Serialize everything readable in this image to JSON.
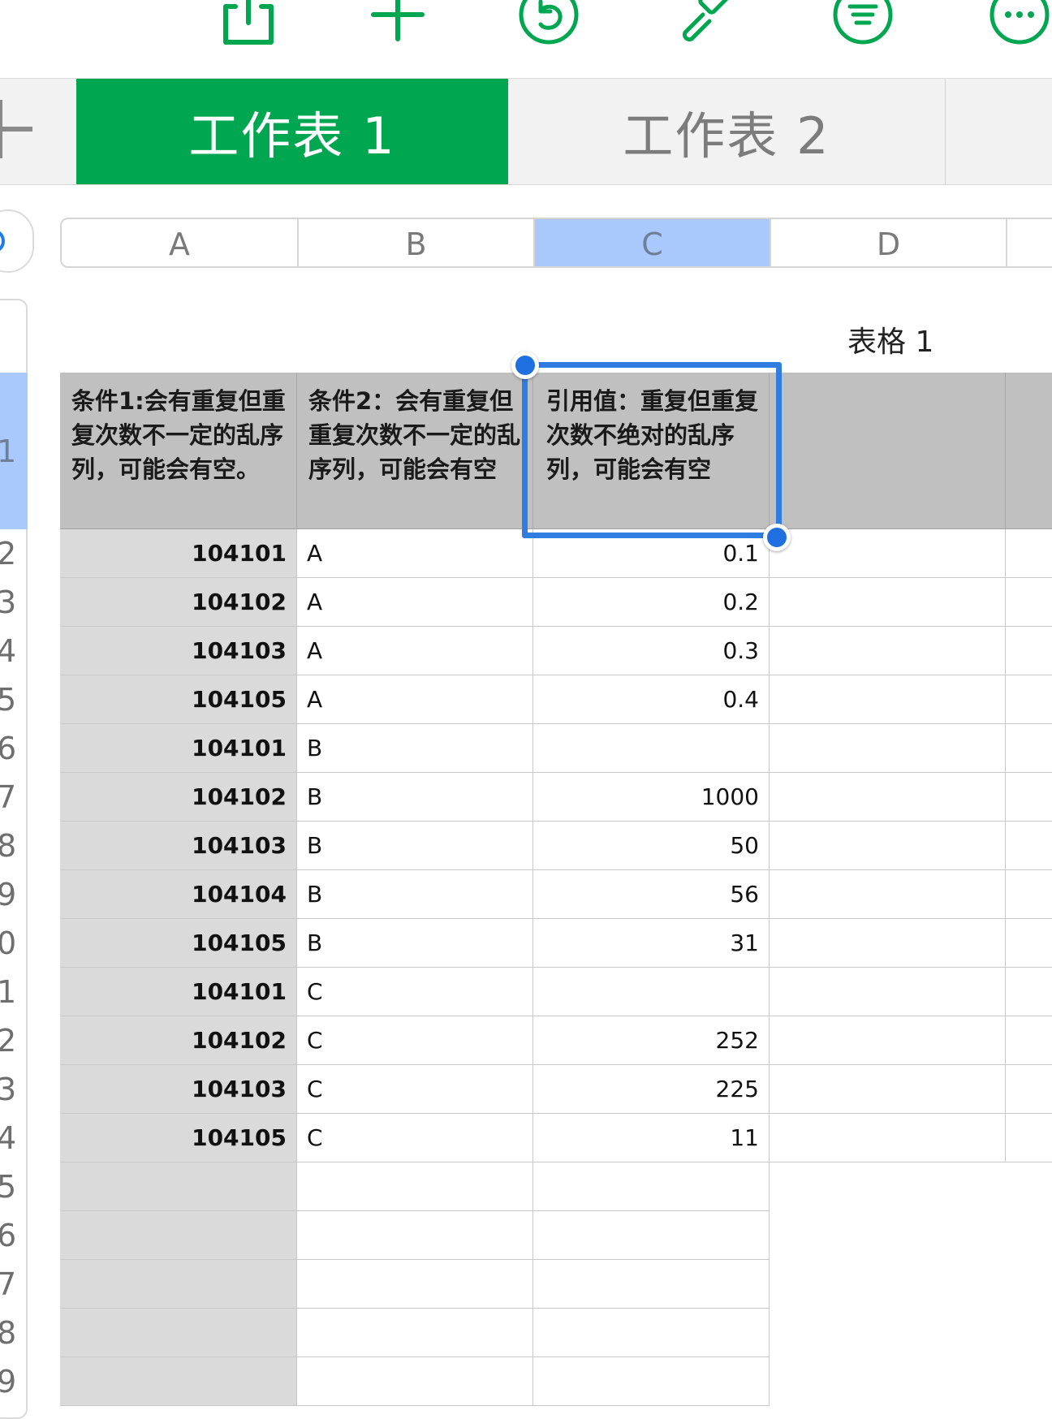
{
  "toolbar": {
    "icons": [
      "back-icon",
      "share-icon",
      "add-icon",
      "undo-icon",
      "brush-icon",
      "format-icon",
      "more-icon"
    ],
    "accent": "#00a650"
  },
  "tabs": {
    "items": [
      {
        "label": "工作表 1",
        "active": true
      },
      {
        "label": "工作表 2",
        "active": false
      }
    ]
  },
  "columns": [
    "A",
    "B",
    "C",
    "D"
  ],
  "selected_column": "C",
  "row_numbers": [
    "1",
    "2",
    "3",
    "4",
    "5",
    "6",
    "7",
    "8",
    "9",
    "0",
    "1",
    "2",
    "3",
    "4",
    "5",
    "6",
    "7",
    "8",
    "9"
  ],
  "table": {
    "title": "表格 1",
    "headers": [
      "条件1:会有重复但重复次数不一定的乱序列，可能会有空。",
      "条件2：会有重复但重复次数不一定的乱序列，可能会有空",
      "引用值：重复但重复次数不绝对的乱序列，可能会有空",
      ""
    ],
    "rows": [
      {
        "a": "104101",
        "b": "A",
        "c": "0.1"
      },
      {
        "a": "104102",
        "b": "A",
        "c": "0.2"
      },
      {
        "a": "104103",
        "b": "A",
        "c": "0.3"
      },
      {
        "a": "104105",
        "b": "A",
        "c": "0.4"
      },
      {
        "a": "104101",
        "b": "B",
        "c": ""
      },
      {
        "a": "104102",
        "b": "B",
        "c": "1000"
      },
      {
        "a": "104103",
        "b": "B",
        "c": "50"
      },
      {
        "a": "104104",
        "b": "B",
        "c": "56"
      },
      {
        "a": "104105",
        "b": "B",
        "c": "31"
      },
      {
        "a": "104101",
        "b": "C",
        "c": ""
      },
      {
        "a": "104102",
        "b": "C",
        "c": "252"
      },
      {
        "a": "104103",
        "b": "C",
        "c": "225"
      },
      {
        "a": "104105",
        "b": "C",
        "c": "11"
      },
      {
        "a": "",
        "b": "",
        "c": ""
      },
      {
        "a": "",
        "b": "",
        "c": ""
      },
      {
        "a": "",
        "b": "",
        "c": ""
      },
      {
        "a": "",
        "b": "",
        "c": ""
      },
      {
        "a": "",
        "b": "",
        "c": ""
      }
    ]
  }
}
